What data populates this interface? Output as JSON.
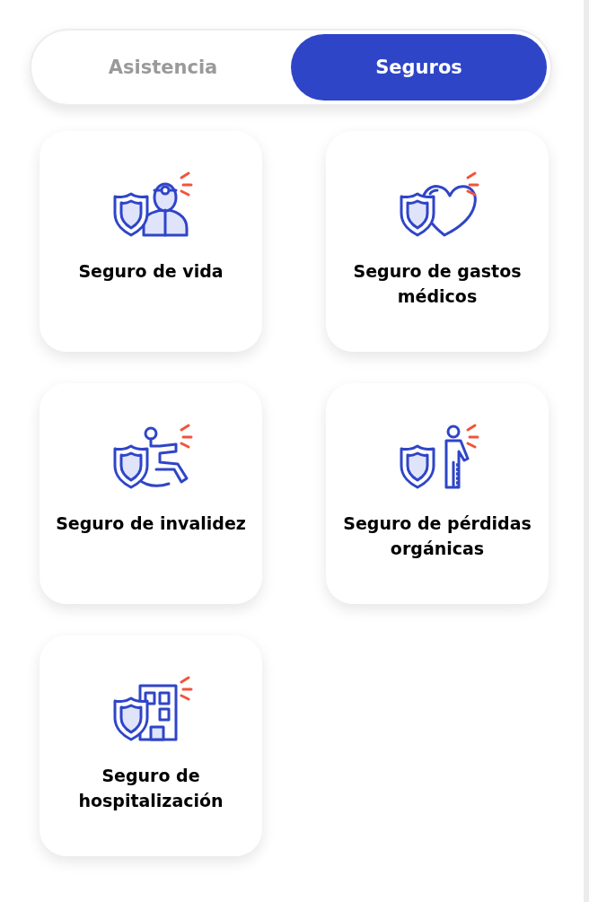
{
  "tabs": [
    {
      "label": "Asistencia",
      "selected": false
    },
    {
      "label": "Seguros",
      "selected": true
    }
  ],
  "cards": [
    {
      "kind": "life",
      "title": "Seguro de vida"
    },
    {
      "kind": "medical",
      "title": "Seguro de gastos médicos"
    },
    {
      "kind": "disability",
      "title": "Seguro de invalidez"
    },
    {
      "kind": "organ",
      "title": "Seguro de pérdidas orgánicas"
    },
    {
      "kind": "hospital",
      "title": "Seguro de hospitalización"
    }
  ]
}
